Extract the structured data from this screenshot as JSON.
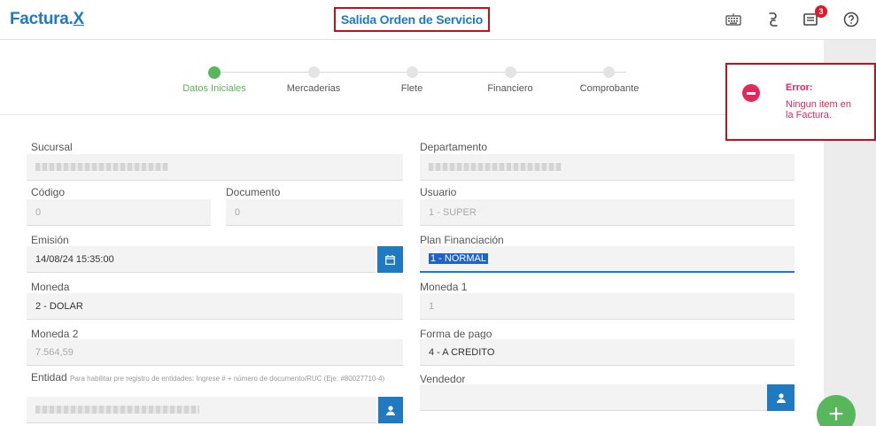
{
  "header": {
    "logo": "Factura",
    "logo_x": "X",
    "title": "Salida Orden de Servicio",
    "notifications_count": "3",
    "icons": [
      "keyboard-icon",
      "link-icon",
      "notifications-icon",
      "help-icon"
    ]
  },
  "stepper": {
    "steps": [
      {
        "label": "Datos Iniciales",
        "active": true
      },
      {
        "label": "Mercaderias",
        "active": false
      },
      {
        "label": "Flete",
        "active": false
      },
      {
        "label": "Financiero",
        "active": false
      },
      {
        "label": "Comprobante",
        "active": false
      }
    ]
  },
  "error": {
    "title": "Error:",
    "message": "Ningun item en la Factura."
  },
  "form": {
    "sucursal": {
      "label": "Sucursal"
    },
    "departamento": {
      "label": "Departamento"
    },
    "codigo": {
      "label": "Código",
      "value": "0"
    },
    "documento": {
      "label": "Documento",
      "value": "0"
    },
    "usuario": {
      "label": "Usuario",
      "value": "1 - SUPER"
    },
    "emision": {
      "label": "Emisión",
      "value": "14/08/24 15:35:00"
    },
    "plan": {
      "label": "Plan Financiación",
      "value": "1 - NORMAL"
    },
    "moneda": {
      "label": "Moneda",
      "value": "2 - DOLAR"
    },
    "moneda1": {
      "label": "Moneda 1",
      "value": "1"
    },
    "moneda2": {
      "label": "Moneda 2",
      "value": "7.564,59"
    },
    "forma_pago": {
      "label": "Forma de pago",
      "value": "4 - A CREDITO"
    },
    "entidad": {
      "label": "Entidad",
      "hint": "Para habilitar pre registro de entidades: Ingrese # + número de documento/RUC (Eje: #80027710-4)"
    },
    "vendedor": {
      "label": "Vendedor"
    }
  },
  "colors": {
    "accent": "#1f7ac2",
    "success": "#57b75a",
    "error": "#e8265a",
    "highlight_border": "#c0121d"
  }
}
